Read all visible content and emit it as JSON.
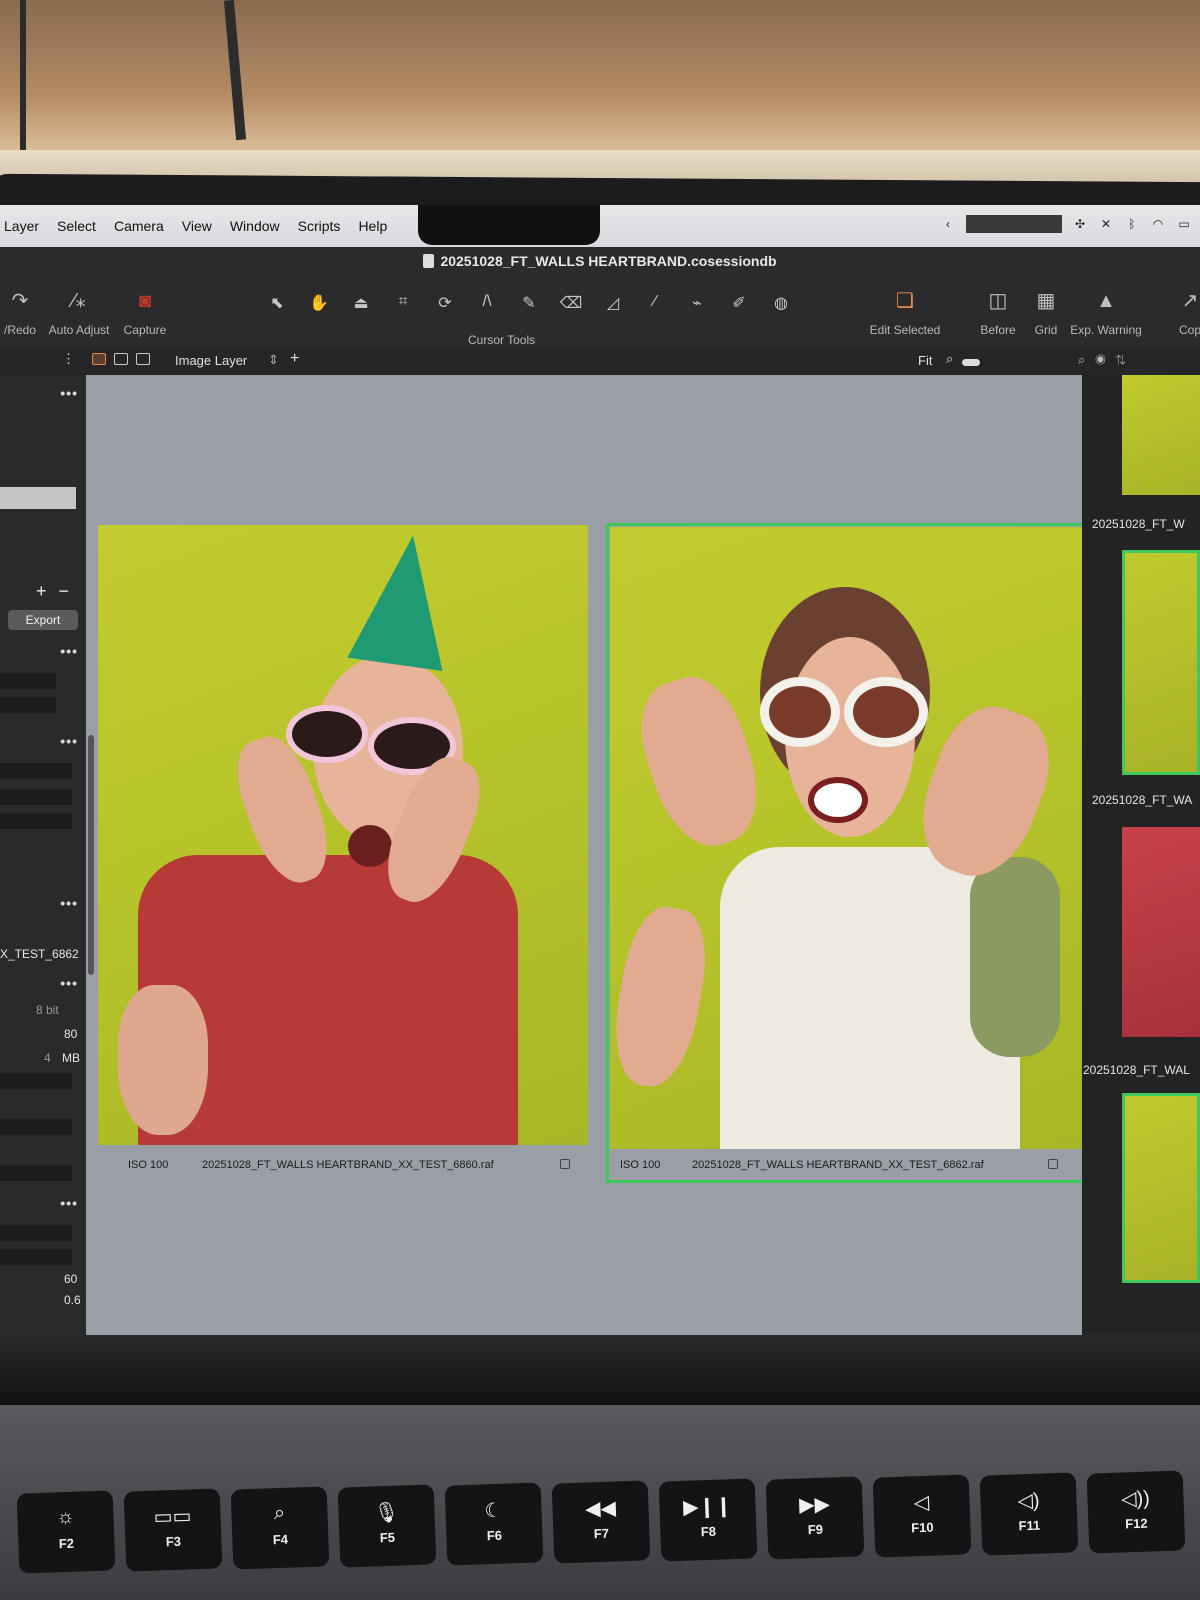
{
  "menubar": {
    "items": [
      "Layer",
      "Select",
      "Camera",
      "View",
      "Window",
      "Scripts",
      "Help"
    ]
  },
  "window": {
    "title": "20251028_FT_WALLS HEARTBRAND.cosessiondb"
  },
  "toolbar": {
    "undo_label": "/Redo",
    "auto_adjust_label": "Auto Adjust",
    "capture_label": "Capture",
    "cursor_tools_label": "Cursor Tools",
    "edit_selected_label": "Edit Selected",
    "before_label": "Before",
    "grid_label": "Grid",
    "exp_warning_label": "Exp. Warning",
    "copy_label": "Cop"
  },
  "subbar": {
    "layer_select": "Image Layer",
    "fit_label": "Fit"
  },
  "left_panel": {
    "export_label": "Export",
    "filename_fragment": "X_TEST_6862",
    "bit_depth": "8 bit",
    "value_80": "80",
    "size_unit": "MB",
    "size_value": "4",
    "value_60": "60",
    "value_06": "0.6"
  },
  "viewer": {
    "photos": [
      {
        "iso": "ISO 100",
        "filename": "20251028_FT_WALLS HEARTBRAND_XX_TEST_6860.raf",
        "selected": false
      },
      {
        "iso": "ISO 100",
        "filename": "20251028_FT_WALLS HEARTBRAND_XX_TEST_6862.raf",
        "selected": true
      }
    ]
  },
  "filmstrip": {
    "names": [
      "20251028_FT_W",
      "20251028_FT_WA",
      "20251028_FT_WAL"
    ]
  },
  "keyboard": {
    "keys": [
      {
        "label": "F2",
        "icon": "brightness-up-icon",
        "glyph": "☼"
      },
      {
        "label": "F3",
        "icon": "mission-control-icon",
        "glyph": "▭▭"
      },
      {
        "label": "F4",
        "icon": "search-icon",
        "glyph": "⌕"
      },
      {
        "label": "F5",
        "icon": "microphone-icon",
        "glyph": "🎙"
      },
      {
        "label": "F6",
        "icon": "moon-icon",
        "glyph": "☾"
      },
      {
        "label": "F7",
        "icon": "rewind-icon",
        "glyph": "◀◀"
      },
      {
        "label": "F8",
        "icon": "play-pause-icon",
        "glyph": "▶❙❙"
      },
      {
        "label": "F9",
        "icon": "fast-forward-icon",
        "glyph": "▶▶"
      },
      {
        "label": "F10",
        "icon": "mute-icon",
        "glyph": "◁"
      },
      {
        "label": "F11",
        "icon": "volume-down-icon",
        "glyph": "◁)"
      },
      {
        "label": "F12",
        "icon": "volume-up-icon",
        "glyph": "◁))"
      }
    ]
  },
  "colors": {
    "selection": "#3cc85a",
    "accent": "#e98b4a",
    "backdrop": "#b6c42a",
    "viewer_bg": "#9a9ea6"
  }
}
